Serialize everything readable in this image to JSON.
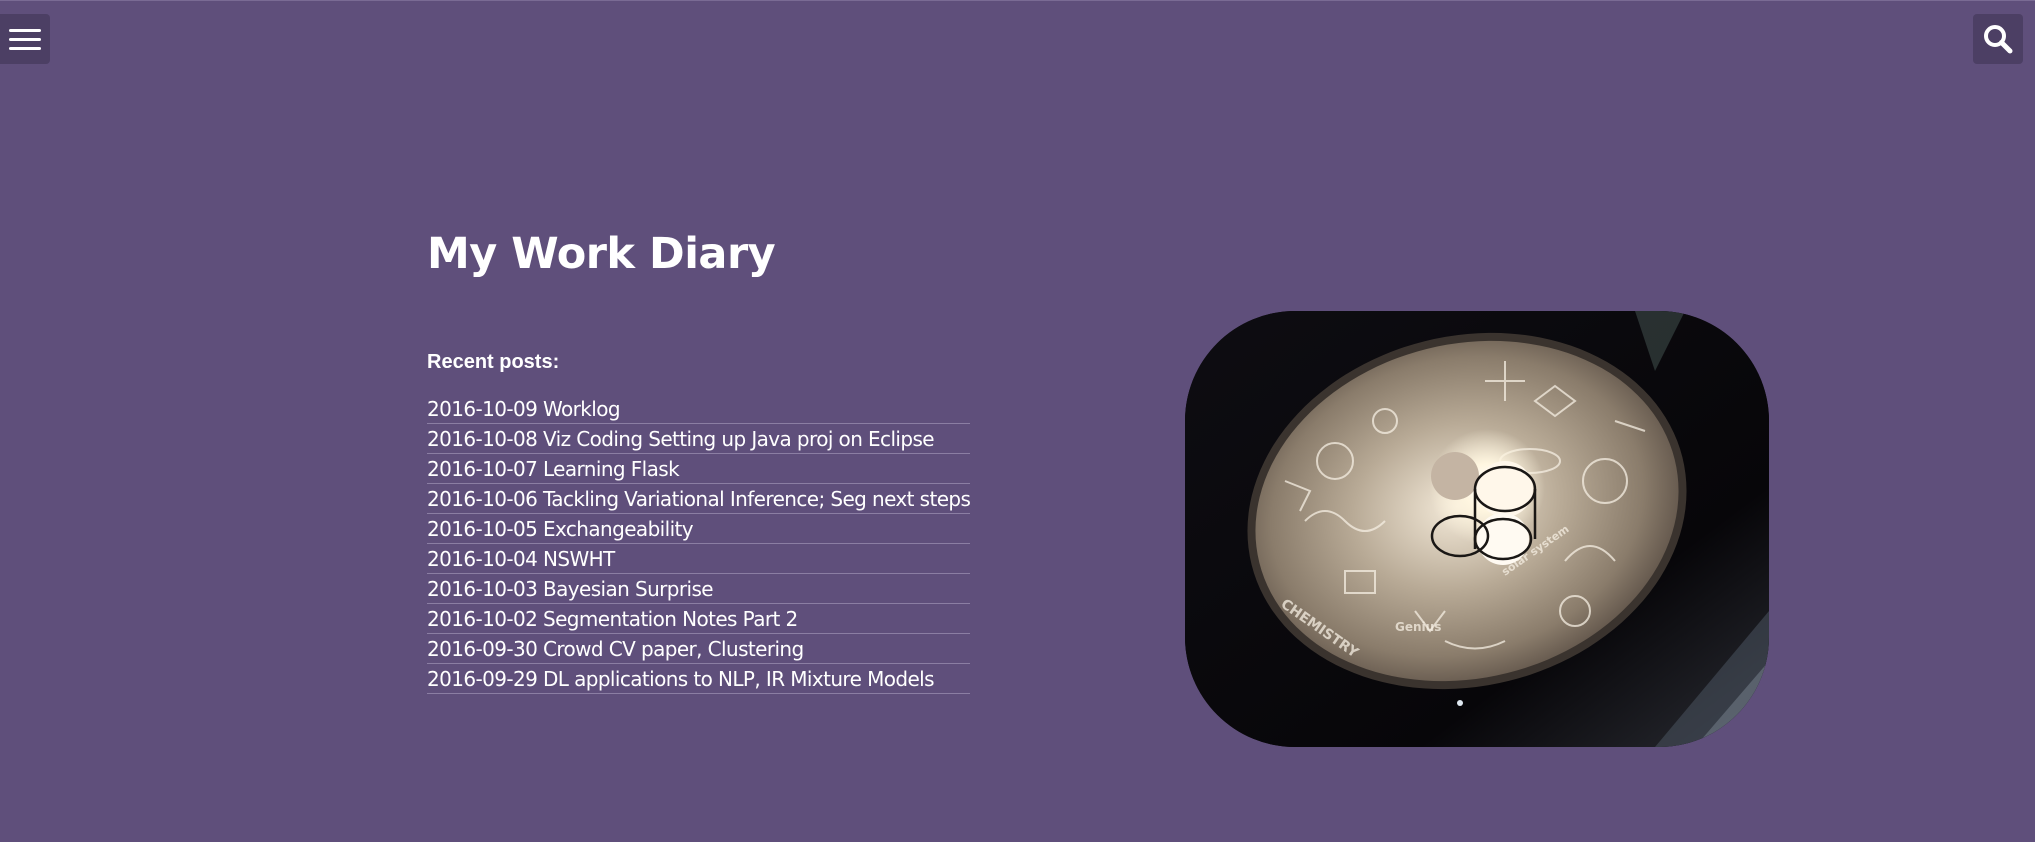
{
  "header": {
    "menu_icon": "hamburger-menu-icon",
    "search_icon": "search-icon"
  },
  "main": {
    "site_title": "My Work Diary",
    "recent_heading": "Recent posts:",
    "posts": [
      {
        "label": "2016-10-09 Worklog"
      },
      {
        "label": "2016-10-08 Viz Coding Setting up Java proj on Eclipse"
      },
      {
        "label": "2016-10-07 Learning Flask"
      },
      {
        "label": "2016-10-06 Tackling Variational Inference; Seg next steps"
      },
      {
        "label": "2016-10-05 Exchangeability"
      },
      {
        "label": "2016-10-04 NSWHT"
      },
      {
        "label": "2016-10-03 Bayesian Surprise"
      },
      {
        "label": "2016-10-02 Segmentation Notes Part 2"
      },
      {
        "label": "2016-09-30 Crowd CV paper, Clustering"
      },
      {
        "label": "2016-09-29 DL applications to NLP, IR Mixture Models"
      }
    ]
  },
  "hero_image": {
    "subject": "lamp-shade-photo",
    "lampshade_words": [
      "CHEMISTRY",
      "Genius",
      "solar system"
    ]
  },
  "colors": {
    "background": "#5f4f7b",
    "button_bg": "#4c3f64",
    "divider": "#8b7ea3",
    "text": "#ffffff"
  }
}
